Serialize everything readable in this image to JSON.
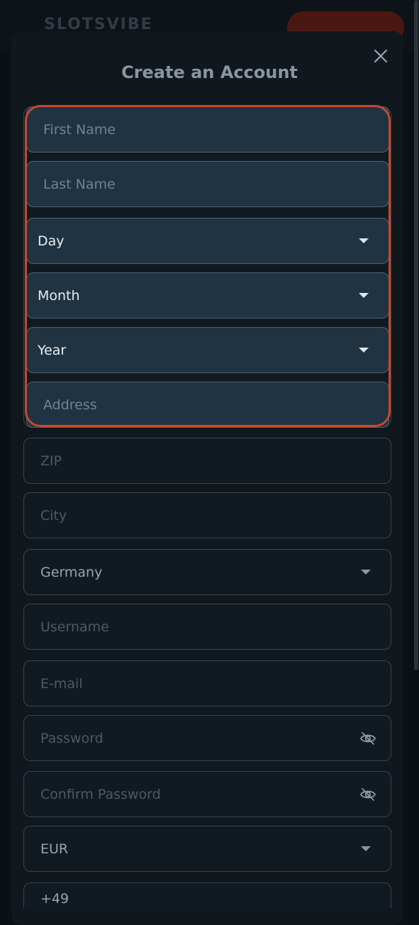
{
  "background": {
    "logo_text": "SLOTSVIBE",
    "scrollbar": true
  },
  "modal": {
    "title": "Create an Account",
    "close_icon": "close-icon"
  },
  "form": {
    "first_name_placeholder": "First Name",
    "last_name_placeholder": "Last Name",
    "day_value": "Day",
    "month_value": "Month",
    "year_value": "Year",
    "address_placeholder": "Address",
    "zip_placeholder": "ZIP",
    "city_placeholder": "City",
    "country_value": "Germany",
    "username_placeholder": "Username",
    "email_placeholder": "E-mail",
    "password_placeholder": "Password",
    "confirm_password_placeholder": "Confirm Password",
    "currency_value": "EUR",
    "phone_prefix": "+49"
  },
  "colors": {
    "highlight_border": "#c8472a",
    "field_bg": "#111a20",
    "highlight_field_bg": "#1f3342"
  }
}
